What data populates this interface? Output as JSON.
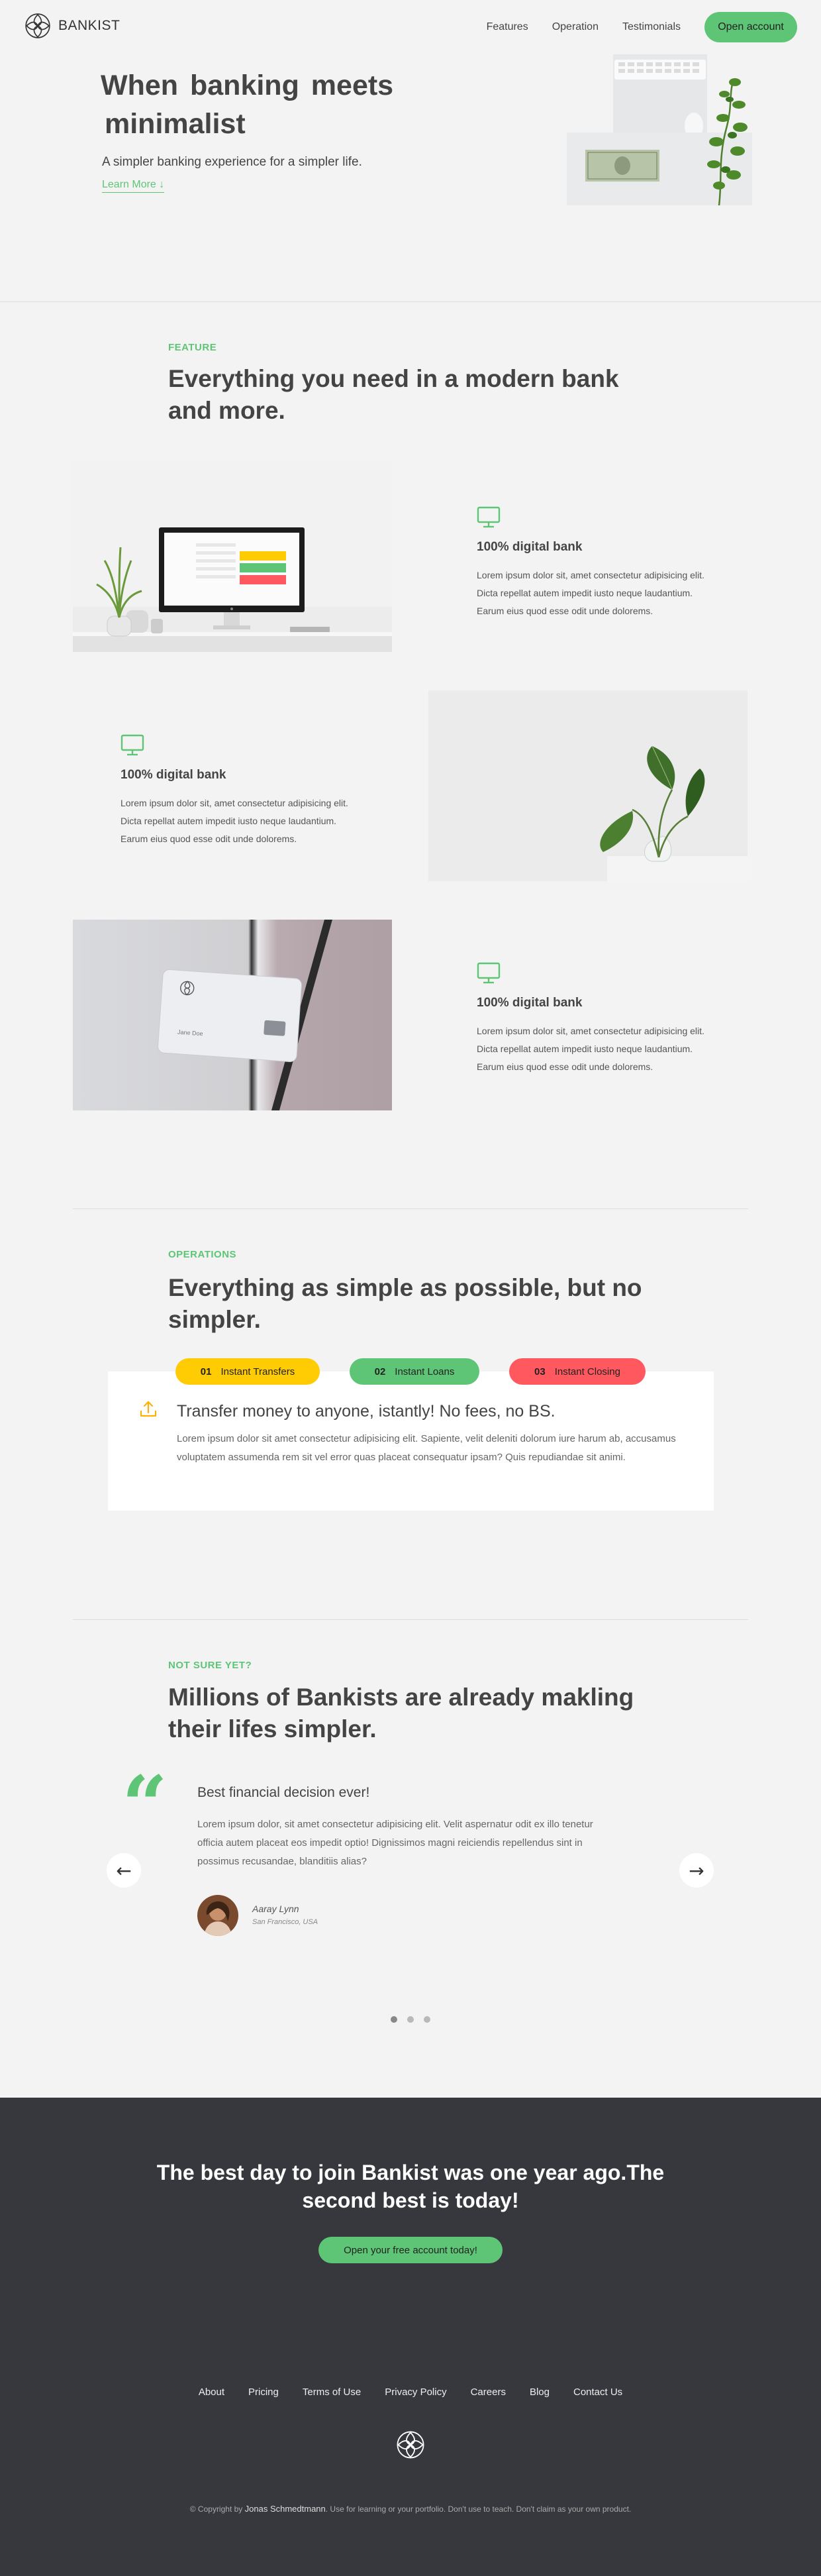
{
  "brand": {
    "name": "BANKIST"
  },
  "nav": {
    "links": [
      "Features",
      "Operation",
      "Testimonials"
    ],
    "cta": "Open account"
  },
  "hero": {
    "title_prefix": "When",
    "title_hl1": "banking",
    "title_mid": "meets",
    "title_hl2": "minimalist",
    "subtitle": "A simpler banking experience for a simpler life.",
    "link": "Learn More ↓"
  },
  "features": {
    "label": "FEATURE",
    "heading": "Everything you need in a modern bank and more.",
    "items": [
      {
        "title": "100% digital bank",
        "desc": "Lorem ipsum dolor sit, amet consectetur adipisicing elit. Dicta repellat autem impedit iusto neque laudantium. Earum eius quod esse odit unde dolorems."
      },
      {
        "title": "100% digital bank",
        "desc": "Lorem ipsum dolor sit, amet consectetur adipisicing elit. Dicta repellat autem impedit iusto neque laudantium. Earum eius quod esse odit unde dolorems."
      },
      {
        "title": "100% digital bank",
        "desc": "Lorem ipsum dolor sit, amet consectetur adipisicing elit. Dicta repellat autem impedit iusto neque laudantium. Earum eius quod esse odit unde dolorems."
      }
    ],
    "card_holder": "Jane Doe"
  },
  "operations": {
    "label": "OPERATIONS",
    "heading": "Everything as simple as possible, but no simpler.",
    "tabs": [
      {
        "num": "01",
        "label": "Instant Transfers"
      },
      {
        "num": "02",
        "label": "Instant Loans"
      },
      {
        "num": "03",
        "label": "Instant Closing"
      }
    ],
    "active": {
      "title": "Transfer money to anyone, istantly! No fees, no BS.",
      "desc": "Lorem ipsum dolor sit amet consectetur adipisicing elit. Sapiente, velit deleniti dolorum iure harum ab, accusamus voluptatem assumenda rem sit vel error quas placeat consequatur ipsam? Quis repudiandae sit animi."
    }
  },
  "testimonials": {
    "label": "NOT SURE YET?",
    "heading": "Millions of Bankists are already makling their lifes simpler.",
    "quote": "“",
    "title": "Best financial decision ever!",
    "body": "Lorem ipsum dolor, sit amet consectetur adipisicing elit. Velit aspernatur odit ex illo tenetur officia autem placeat eos impedit optio! Dignissimos magni reiciendis repellendus sint in possimus recusandae, blanditiis alias?",
    "name": "Aaray Lynn",
    "location": "San Francisco, USA",
    "prev": "←",
    "next": "→",
    "slides_total": 3,
    "active_slide": 1
  },
  "signup": {
    "heading": "The best day to join Bankist was one year ago.The second best is today!",
    "cta": "Open your free account today!"
  },
  "footer": {
    "links": [
      "About",
      "Pricing",
      "Terms of Use",
      "Privacy Policy",
      "Careers",
      "Blog",
      "Contact Us"
    ],
    "copyright_prefix": "© Copyright by",
    "copyright_author": "Jonas Schmedtmann",
    "copyright_suffix": ". Use for learning or your portfolio. Don't use to teach. Don't claim as your own product."
  },
  "colors": {
    "primary": "#5ec576",
    "yellow": "#ffcb03",
    "red": "#ff585f",
    "dark": "#37383d",
    "bg": "#f3f3f3"
  }
}
